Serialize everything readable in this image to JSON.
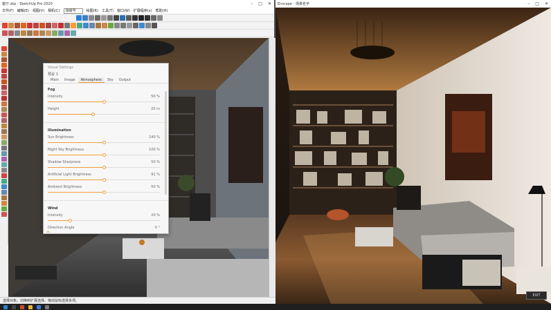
{
  "sketchup": {
    "title": "客厅.skp - SketchUp Pro 2020",
    "menu": [
      "文件(F)",
      "编辑(E)",
      "视图(V)",
      "相机(C)",
      "绘图(R)",
      "工具(T)",
      "窗口(W)",
      "扩展程序(x)",
      "帮助(H)"
    ],
    "scene_select": "场景号",
    "status_text": "选择对象。切换到扩展选择。拖动鼠标选择多项。"
  },
  "dialog": {
    "title": "Visual Settings",
    "preset": "预设 1",
    "tabs": [
      "Main",
      "Image",
      "Atmosphere",
      "Sky",
      "Output"
    ],
    "active_tab": "Atmosphere",
    "sections": [
      {
        "title": "Fog",
        "rows": [
          {
            "label": "Intensity",
            "value": "50 %",
            "fraction": 0.5
          },
          {
            "label": "Height",
            "value": "20 m",
            "fraction": 0.4
          }
        ]
      },
      {
        "title": "Illumination",
        "rows": [
          {
            "label": "Sun Brightness",
            "value": "140 %",
            "fraction": 0.5
          },
          {
            "label": "Night Sky Brightness",
            "value": "100 %",
            "fraction": 0.5
          },
          {
            "label": "Shadow Sharpness",
            "value": "50 %",
            "fraction": 0.5
          },
          {
            "label": "Artificial Light Brightness",
            "value": "91 %",
            "fraction": 0.5
          },
          {
            "label": "Ambient Brightness",
            "value": "50 %",
            "fraction": 0.5
          }
        ]
      },
      {
        "title": "Wind",
        "rows": [
          {
            "label": "Intensity",
            "value": "20 %",
            "fraction": 0.2
          },
          {
            "label": "Direction Angle",
            "value": "0 °",
            "fraction": 0.0
          }
        ]
      }
    ]
  },
  "enscape": {
    "title": "Enscape - 场景名字",
    "button": "EXIT"
  },
  "colors": {
    "accent": "#f39c3a",
    "render_wall": "#e8e2da",
    "render_floor": "#6b4a2c",
    "ceiling": "#a06f3c"
  }
}
